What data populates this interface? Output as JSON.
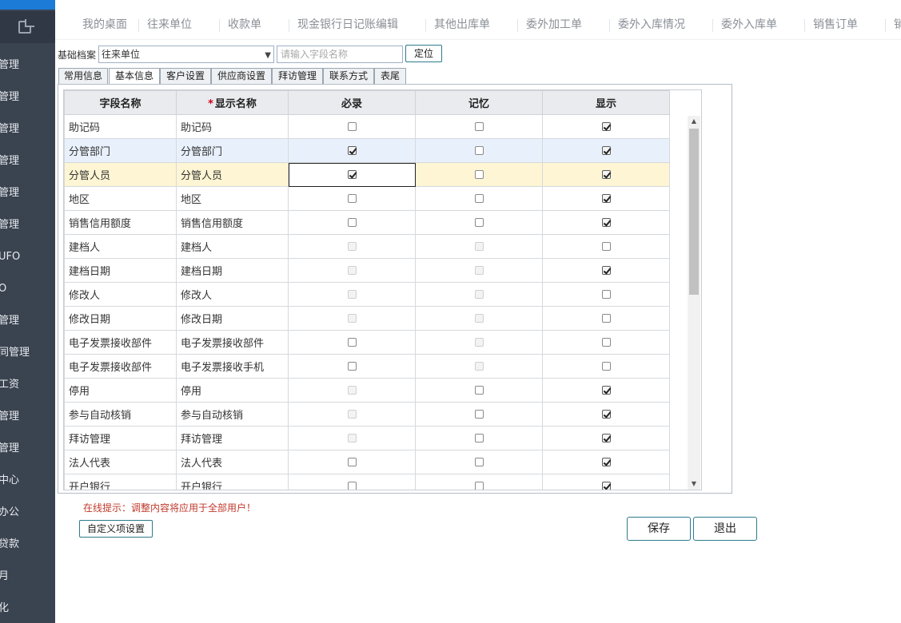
{
  "sidebar": {
    "items": [
      {
        "label": "管理"
      },
      {
        "label": "管理"
      },
      {
        "label": "管理"
      },
      {
        "label": "管理"
      },
      {
        "label": "管理"
      },
      {
        "label": "管理"
      },
      {
        "label": "UFO"
      },
      {
        "label": "O"
      },
      {
        "label": "管理"
      },
      {
        "label": "同管理"
      },
      {
        "label": "工资"
      },
      {
        "label": "管理"
      },
      {
        "label": "管理"
      },
      {
        "label": "中心"
      },
      {
        "label": "办公"
      },
      {
        "label": "贷款"
      },
      {
        "label": "月"
      },
      {
        "label": "化"
      }
    ]
  },
  "topnav": {
    "tabs": [
      {
        "label": "我的桌面"
      },
      {
        "label": "往来单位"
      },
      {
        "label": "收款单"
      },
      {
        "label": "现金银行日记账编辑"
      },
      {
        "label": "其他出库单"
      },
      {
        "label": "委外加工单"
      },
      {
        "label": "委外入库情况"
      },
      {
        "label": "委外入库单"
      },
      {
        "label": "销售订单"
      },
      {
        "label": "销"
      }
    ]
  },
  "toolbar": {
    "archive_label": "基础档案",
    "archive_value": "往来单位",
    "search_placeholder": "请输入字段名称",
    "locate_label": "定位"
  },
  "settings_tabs": [
    {
      "label": "常用信息"
    },
    {
      "label": "基本信息"
    },
    {
      "label": "客户设置"
    },
    {
      "label": "供应商设置"
    },
    {
      "label": "拜访管理"
    },
    {
      "label": "联系方式"
    },
    {
      "label": "表尾"
    }
  ],
  "grid": {
    "headers": {
      "field": "字段名称",
      "display_star": "*",
      "display": "显示名称",
      "required": "必录",
      "remember": "记忆",
      "show": "显示"
    },
    "rows": [
      {
        "field": "助记码",
        "display": "助记码",
        "required": "off",
        "remember": "off",
        "show": "on"
      },
      {
        "field": "分管部门",
        "display": "分管部门",
        "required": "on",
        "remember": "off",
        "show": "on"
      },
      {
        "field": "分管人员",
        "display": "分管人员",
        "required": "on",
        "remember": "off",
        "show": "on"
      },
      {
        "field": "地区",
        "display": "地区",
        "required": "off",
        "remember": "off",
        "show": "on"
      },
      {
        "field": "销售信用额度",
        "display": "销售信用额度",
        "required": "off",
        "remember": "off",
        "show": "on"
      },
      {
        "field": "建档人",
        "display": "建档人",
        "required": "disabled",
        "remember": "disabled",
        "show": "off"
      },
      {
        "field": "建档日期",
        "display": "建档日期",
        "required": "disabled",
        "remember": "disabled",
        "show": "on"
      },
      {
        "field": "修改人",
        "display": "修改人",
        "required": "disabled",
        "remember": "disabled",
        "show": "off"
      },
      {
        "field": "修改日期",
        "display": "修改日期",
        "required": "disabled",
        "remember": "disabled",
        "show": "off"
      },
      {
        "field": "电子发票接收部件",
        "display": "电子发票接收部件",
        "required": "off",
        "remember": "disabled",
        "show": "off"
      },
      {
        "field": "电子发票接收部件",
        "display": "电子发票接收手机",
        "required": "off",
        "remember": "disabled",
        "show": "off"
      },
      {
        "field": "停用",
        "display": "停用",
        "required": "disabled",
        "remember": "off",
        "show": "on"
      },
      {
        "field": "参与自动核销",
        "display": "参与自动核销",
        "required": "disabled",
        "remember": "off",
        "show": "on"
      },
      {
        "field": "拜访管理",
        "display": "拜访管理",
        "required": "disabled",
        "remember": "off",
        "show": "on"
      },
      {
        "field": "法人代表",
        "display": "法人代表",
        "required": "off",
        "remember": "off",
        "show": "on"
      },
      {
        "field": "开户银行",
        "display": "开户银行",
        "required": "off",
        "remember": "off",
        "show": "on"
      }
    ]
  },
  "footer": {
    "hint": "在线提示：调整内容将应用于全部用户！",
    "custom_label": "自定义项设置",
    "save_label": "保存",
    "exit_label": "退出"
  },
  "colors": {
    "sidebar_bg": "#3a4350",
    "accent": "#1b7bd6",
    "button_border": "#2d7b8d",
    "hint_red": "#c0392b"
  }
}
